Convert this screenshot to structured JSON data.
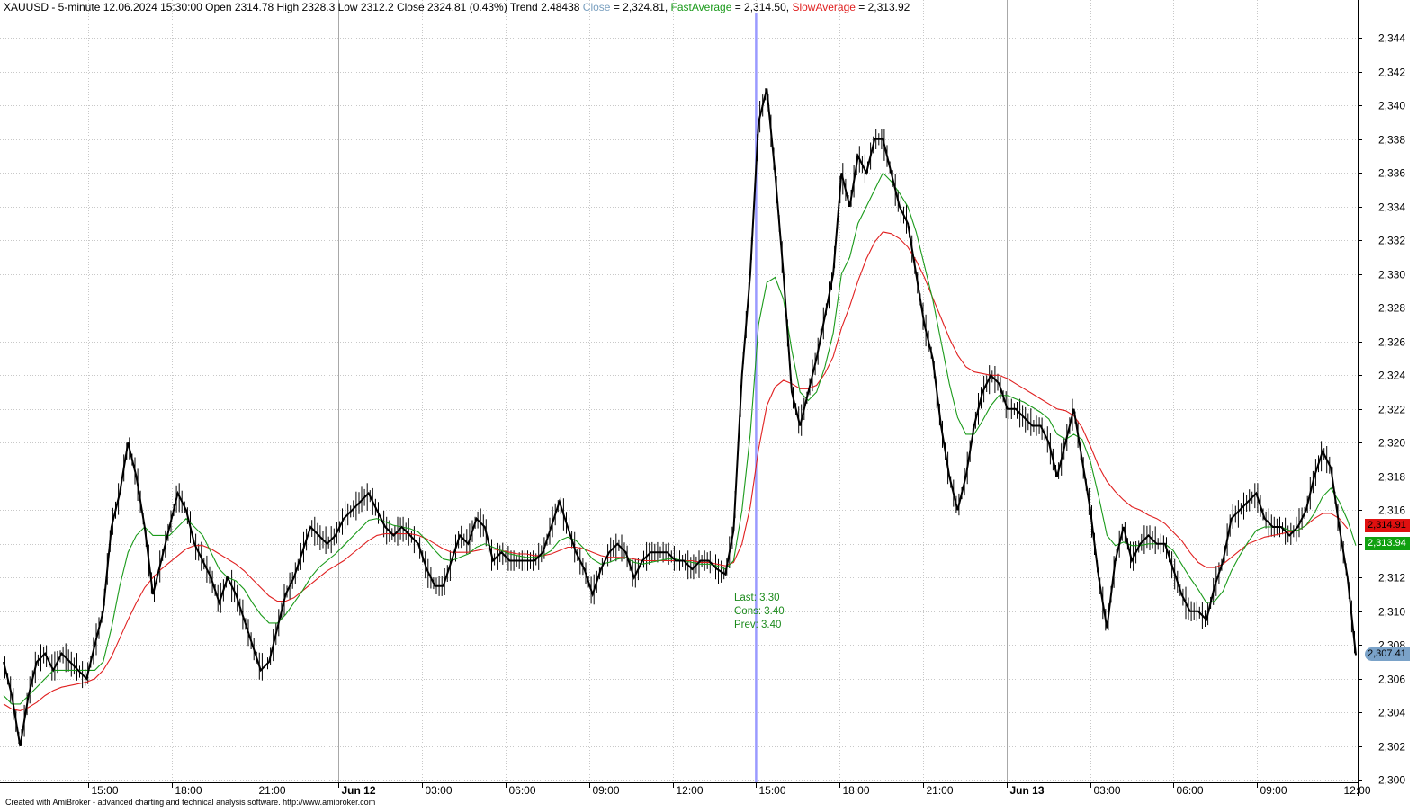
{
  "header": {
    "symbol_info": "XAUUSD - 5-minute 12.06.2024 15:30:00 Open 2314.78 High 2328.3 Low 2312.2 Close 2324.81 (0.43%) Trend 2.48438",
    "close_label": "Close",
    "close_value": " = 2,324.81, ",
    "fast_label": "FastAverage",
    "fast_value": " = 2,314.50, ",
    "slow_label": "SlowAverage",
    "slow_value": " = 2,313.92"
  },
  "annotation": {
    "last": "Last: 3.30",
    "cons": "Cons: 3.40",
    "prev": "Prev: 3.40"
  },
  "tags": {
    "slow": "2,314.91",
    "fast": "2,313.94",
    "close": "2,307.41"
  },
  "footer": "Created with AmiBroker - advanced charting and technical analysis software. http://www.amibroker.com",
  "colors": {
    "price": "#000000",
    "fast_average": "#1a9a1a",
    "slow_average": "#e02020",
    "close_label": "#7aa0c0",
    "cursor": "#9a9aff",
    "grid": "#c8c8c8",
    "tag_slow": "#e01010",
    "tag_fast": "#10a010",
    "tag_close": "#7aa2c8"
  },
  "chart_data": {
    "type": "line",
    "ylim": [
      2300,
      2345
    ],
    "y_ticks": [
      "2,300",
      "2,302",
      "2,304",
      "2,306",
      "2,308",
      "2,310",
      "2,312",
      "2,314",
      "2,316",
      "2,318",
      "2,320",
      "2,322",
      "2,324",
      "2,326",
      "2,328",
      "2,330",
      "2,332",
      "2,334",
      "2,336",
      "2,338",
      "2,340",
      "2,342",
      "2,344"
    ],
    "x_ticks": [
      "15:00",
      "18:00",
      "21:00",
      "Jun 12",
      "03:00",
      "06:00",
      "09:00",
      "12:00",
      "15:00",
      "18:00",
      "21:00",
      "Jun 13",
      "03:00",
      "06:00",
      "09:00",
      "12:00"
    ],
    "bold_x_ticks": [
      "Jun 12",
      "Jun 13"
    ],
    "cursor_label": "15:00",
    "series": [
      {
        "name": "Close",
        "values": [
          2307,
          2305,
          2302,
          2305,
          2307,
          2307.5,
          2306.5,
          2307.5,
          2307,
          2306.5,
          2306,
          2308,
          2310,
          2315,
          2317,
          2320,
          2318,
          2315,
          2311,
          2313,
          2315,
          2317,
          2316,
          2314,
          2313,
          2312,
          2310.5,
          2312,
          2311,
          2309.5,
          2308,
          2306.5,
          2307,
          2309,
          2311,
          2312,
          2313.5,
          2315,
          2314.5,
          2314,
          2314.5,
          2315.5,
          2316,
          2316.5,
          2317,
          2316,
          2315,
          2314.5,
          2315,
          2314.5,
          2314,
          2312.5,
          2311.5,
          2311.5,
          2313,
          2314.5,
          2314,
          2315.5,
          2315,
          2313,
          2313.5,
          2313,
          2313,
          2313,
          2313,
          2313.5,
          2315,
          2316.5,
          2315,
          2313.5,
          2312.5,
          2311,
          2312.5,
          2313.5,
          2314,
          2313.5,
          2312,
          2313,
          2313.5,
          2313.5,
          2313.5,
          2313,
          2313,
          2312.5,
          2313,
          2313,
          2312.5,
          2312.2,
          2314.8,
          2324,
          2330,
          2339,
          2341,
          2336,
          2330,
          2323,
          2321,
          2323,
          2325,
          2327.5,
          2330,
          2336,
          2334,
          2337,
          2336,
          2338,
          2338,
          2336,
          2334,
          2333,
          2330,
          2327,
          2325,
          2321,
          2318,
          2316,
          2318,
          2321,
          2323,
          2324,
          2323.5,
          2322,
          2322,
          2321.5,
          2321,
          2321,
          2320,
          2318,
          2320,
          2322,
          2319,
          2316,
          2312,
          2309,
          2313,
          2315,
          2313,
          2314,
          2314.5,
          2314,
          2314,
          2312.5,
          2311,
          2310,
          2310,
          2309.5,
          2311.5,
          2313,
          2315.5,
          2316,
          2316.5,
          2317,
          2315.5,
          2315,
          2315,
          2314.5,
          2315,
          2316,
          2318,
          2319.5,
          2318.5,
          2315,
          2312,
          2307.4
        ]
      },
      {
        "name": "FastAverage",
        "values": [
          2305,
          2304.5,
          2304.5,
          2305,
          2305.5,
          2306,
          2306.5,
          2306.5,
          2306.5,
          2306.5,
          2306.5,
          2306.5,
          2307,
          2309,
          2311.5,
          2313.5,
          2314.5,
          2315,
          2314.5,
          2314.5,
          2314.5,
          2315,
          2315.5,
          2315,
          2314.5,
          2313.5,
          2312.5,
          2312,
          2311.8,
          2311.3,
          2310.5,
          2309.8,
          2309.3,
          2309.3,
          2309.8,
          2310.5,
          2311.2,
          2312,
          2312.6,
          2313,
          2313.4,
          2313.9,
          2314.4,
          2314.9,
          2315.4,
          2315.5,
          2315.3,
          2315.1,
          2315,
          2314.9,
          2314.7,
          2314.2,
          2313.6,
          2313.1,
          2313,
          2313.2,
          2313.4,
          2313.8,
          2314,
          2313.8,
          2313.6,
          2313.4,
          2313.3,
          2313.2,
          2313.2,
          2313.3,
          2313.6,
          2314.2,
          2314.4,
          2314.2,
          2313.7,
          2313.1,
          2312.8,
          2312.9,
          2313.1,
          2313.2,
          2312.9,
          2312.8,
          2312.9,
          2313,
          2313.1,
          2313.1,
          2313,
          2312.9,
          2312.8,
          2312.8,
          2312.7,
          2312.5,
          2313,
          2316,
          2320.5,
          2327,
          2329.5,
          2329.8,
          2328.5,
          2325.5,
          2323,
          2322.5,
          2323,
          2324.5,
          2326.5,
          2330,
          2331,
          2333,
          2334,
          2335,
          2336,
          2335.5,
          2334.8,
          2334,
          2332.5,
          2330.5,
          2328.5,
          2326,
          2323.5,
          2321.5,
          2320.5,
          2320.5,
          2321.3,
          2322.2,
          2322.8,
          2322.8,
          2322.6,
          2322.4,
          2322.1,
          2321.8,
          2321.4,
          2320.5,
          2320.2,
          2320.5,
          2320.2,
          2318.9,
          2316.8,
          2314.5,
          2313.9,
          2314.1,
          2313.9,
          2313.9,
          2314,
          2314,
          2314,
          2313.6,
          2312.8,
          2312,
          2311.3,
          2310.5,
          2310.6,
          2311.2,
          2312.4,
          2313.3,
          2314.1,
          2314.8,
          2315,
          2315,
          2315,
          2314.8,
          2314.8,
          2315.1,
          2315.8,
          2316.8,
          2317.3,
          2316.5,
          2315.4,
          2313.9
        ]
      },
      {
        "name": "SlowAverage",
        "values": [
          2304.5,
          2304.2,
          2304.1,
          2304.3,
          2304.6,
          2305,
          2305.3,
          2305.5,
          2305.6,
          2305.7,
          2305.8,
          2306,
          2306.5,
          2307.3,
          2308.4,
          2309.5,
          2310.5,
          2311.4,
          2312,
          2312.5,
          2312.9,
          2313.3,
          2313.7,
          2313.9,
          2313.9,
          2313.7,
          2313.4,
          2313.1,
          2312.8,
          2312.4,
          2311.9,
          2311.4,
          2310.9,
          2310.6,
          2310.6,
          2310.8,
          2311.2,
          2311.6,
          2312,
          2312.4,
          2312.7,
          2313,
          2313.4,
          2313.8,
          2314.2,
          2314.5,
          2314.6,
          2314.6,
          2314.6,
          2314.6,
          2314.5,
          2314.3,
          2314,
          2313.7,
          2313.5,
          2313.5,
          2313.5,
          2313.6,
          2313.7,
          2313.7,
          2313.6,
          2313.5,
          2313.4,
          2313.4,
          2313.3,
          2313.3,
          2313.4,
          2313.6,
          2313.8,
          2313.8,
          2313.7,
          2313.5,
          2313.3,
          2313.2,
          2313.2,
          2313.2,
          2313.1,
          2313,
          2313,
          2313,
          2313,
          2313,
          2313,
          2313,
          2312.9,
          2312.9,
          2312.8,
          2312.7,
          2312.9,
          2314,
          2316.2,
          2319.6,
          2322.2,
          2323.3,
          2323.7,
          2323.5,
          2323.2,
          2323.2,
          2323.4,
          2324.1,
          2325.1,
          2326.8,
          2328.1,
          2329.6,
          2330.9,
          2331.9,
          2332.5,
          2332.4,
          2332.1,
          2331.6,
          2330.8,
          2329.8,
          2328.6,
          2327.4,
          2326.2,
          2325.2,
          2324.5,
          2324.2,
          2324.1,
          2324,
          2324,
          2323.8,
          2323.5,
          2323.2,
          2322.9,
          2322.6,
          2322.3,
          2322,
          2321.9,
          2321.6,
          2320.9,
          2319.8,
          2318.6,
          2317.7,
          2317.1,
          2316.6,
          2316.2,
          2316,
          2315.7,
          2315.5,
          2315.2,
          2314.7,
          2314.2,
          2313.5,
          2312.9,
          2312.6,
          2312.6,
          2312.8,
          2313.2,
          2313.6,
          2314,
          2314.2,
          2314.4,
          2314.5,
          2314.6,
          2314.7,
          2314.8,
          2315.1,
          2315.5,
          2315.8,
          2315.8,
          2315.5,
          2314.9
        ]
      }
    ]
  }
}
